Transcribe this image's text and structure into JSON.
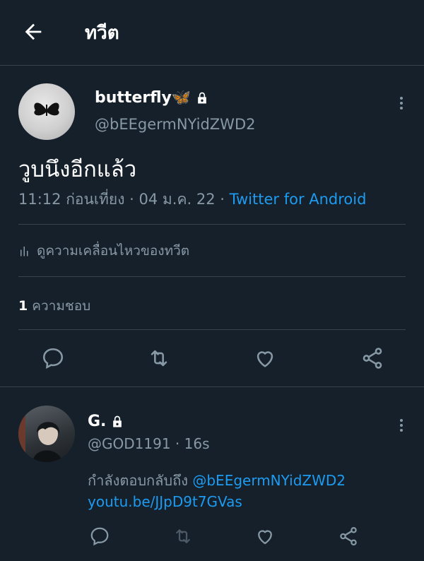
{
  "header": {
    "title": "ทวีต",
    "back_icon": "arrow-left-icon"
  },
  "tweet": {
    "display_name": "butterfly🦋",
    "protected": true,
    "handle": "@bEEgermNYidZWD2",
    "text": "วูบนึงอีกแล้ว",
    "time": "11:12 ก่อนเที่ยง",
    "date": "04 ม.ค. 22",
    "separator": "·",
    "source": "Twitter for Android",
    "activity_label": "ดูความเคลื่อนไหวของทวีต",
    "like_count": "1",
    "like_label": "ความชอบ",
    "actions": [
      "reply-icon",
      "retweet-icon",
      "like-icon",
      "share-icon"
    ]
  },
  "reply": {
    "display_name": "G.",
    "protected": true,
    "handle": "@GOD1191",
    "time_ago": "16s",
    "separator": "·",
    "replying_label": "กำลังตอบกลับถึง",
    "replying_to": "@bEEgermNYidZWD2",
    "link": "youtu.be/JJpD9t7GVas"
  },
  "colors": {
    "background": "#15202b",
    "accent": "#1d9bf0",
    "muted": "#8899a6",
    "divider": "#38444d"
  }
}
